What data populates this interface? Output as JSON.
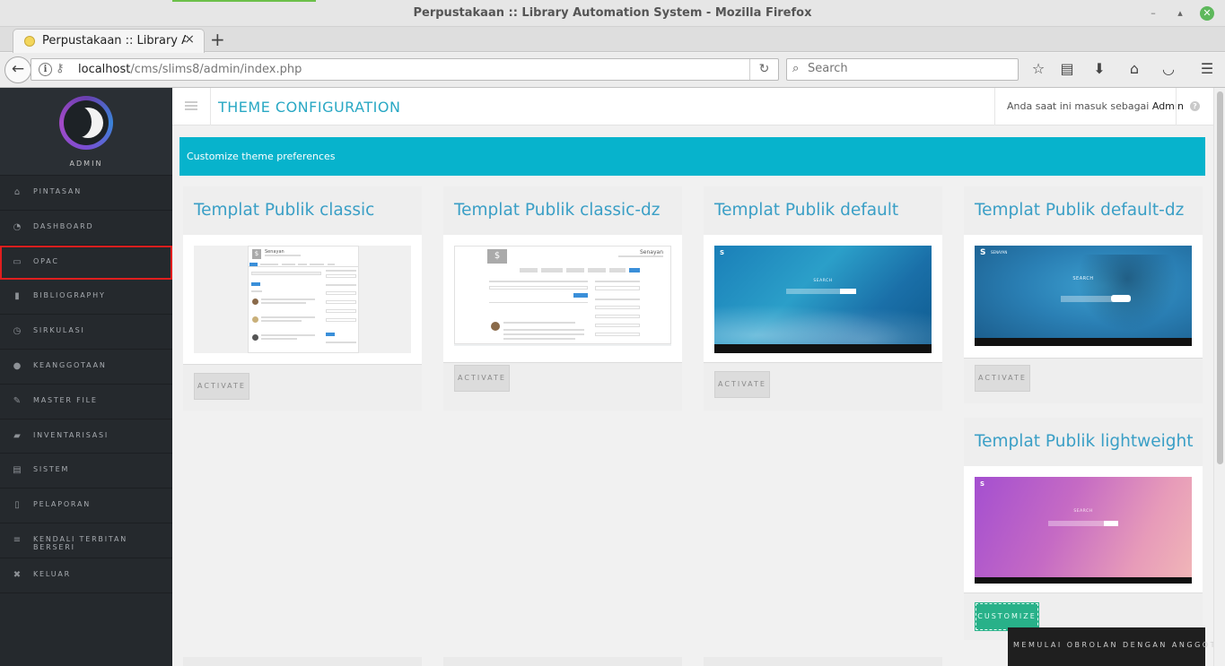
{
  "window": {
    "title": "Perpustakaan :: Library Automation System - Mozilla Firefox"
  },
  "tab": {
    "title": "Perpustakaan :: Library A...",
    "close": "×",
    "new": "+"
  },
  "navbar": {
    "url_host": "localhost",
    "url_path": "/cms/slims8/admin/index.php",
    "search_placeholder": "Search"
  },
  "sidebar": {
    "profile_label": "ADMIN",
    "items": [
      {
        "label": "PINTASAN",
        "icon": "home-icon",
        "glyph": "⌂"
      },
      {
        "label": "DASHBOARD",
        "icon": "dashboard-icon",
        "glyph": "◔"
      },
      {
        "label": "OPAC",
        "icon": "monitor-icon",
        "glyph": "▭"
      },
      {
        "label": "BIBLIOGRAPHY",
        "icon": "bookmark-icon",
        "glyph": "▮"
      },
      {
        "label": "SIRKULASI",
        "icon": "clock-icon",
        "glyph": "◷"
      },
      {
        "label": "KEANGGOTAAN",
        "icon": "user-icon",
        "glyph": "●"
      },
      {
        "label": "MASTER FILE",
        "icon": "pencil-icon",
        "glyph": "✎"
      },
      {
        "label": "INVENTARISASI",
        "icon": "briefcase-icon",
        "glyph": "▰"
      },
      {
        "label": "SISTEM",
        "icon": "keyboard-icon",
        "glyph": "▤"
      },
      {
        "label": "PELAPORAN",
        "icon": "file-icon",
        "glyph": "▯"
      },
      {
        "label": "KENDALI TERBITAN BERSERI",
        "icon": "list-icon",
        "glyph": "≡"
      },
      {
        "label": "KELUAR",
        "icon": "close-icon",
        "glyph": "✖"
      }
    ],
    "selected_index": 2
  },
  "header": {
    "title": "THEME CONFIGURATION",
    "user_prefix": "Anda saat ini masuk sebagai",
    "user_name": "Admin",
    "help": "?"
  },
  "banner": {
    "text": "Customize theme preferences"
  },
  "themes": [
    {
      "title": "Templat Publik classic",
      "button": "ACTIVATE"
    },
    {
      "title": "Templat Publik classic-dz",
      "button": "ACTIVATE"
    },
    {
      "title": "Templat Publik default",
      "button": "ACTIVATE"
    },
    {
      "title": "Templat Publik default-dz",
      "button": "ACTIVATE"
    },
    {
      "title": "Templat Publik lightweight",
      "button": "CUSTOMIZE"
    }
  ],
  "thumbnails": {
    "classic_site": "Senayan",
    "classic_dz_site": "Senayan",
    "search_label": "SEARCH",
    "tree_site": "SENAYAN"
  },
  "chat": {
    "label": "MEMULAI OBROLAN DENGAN ANGGOTA"
  },
  "colors": {
    "accent": "#07b3cc",
    "title_blue": "#3a9fc6",
    "sidebar_bg": "#25292d",
    "customize_green": "#28b189",
    "selected_border": "#e11e1e"
  }
}
